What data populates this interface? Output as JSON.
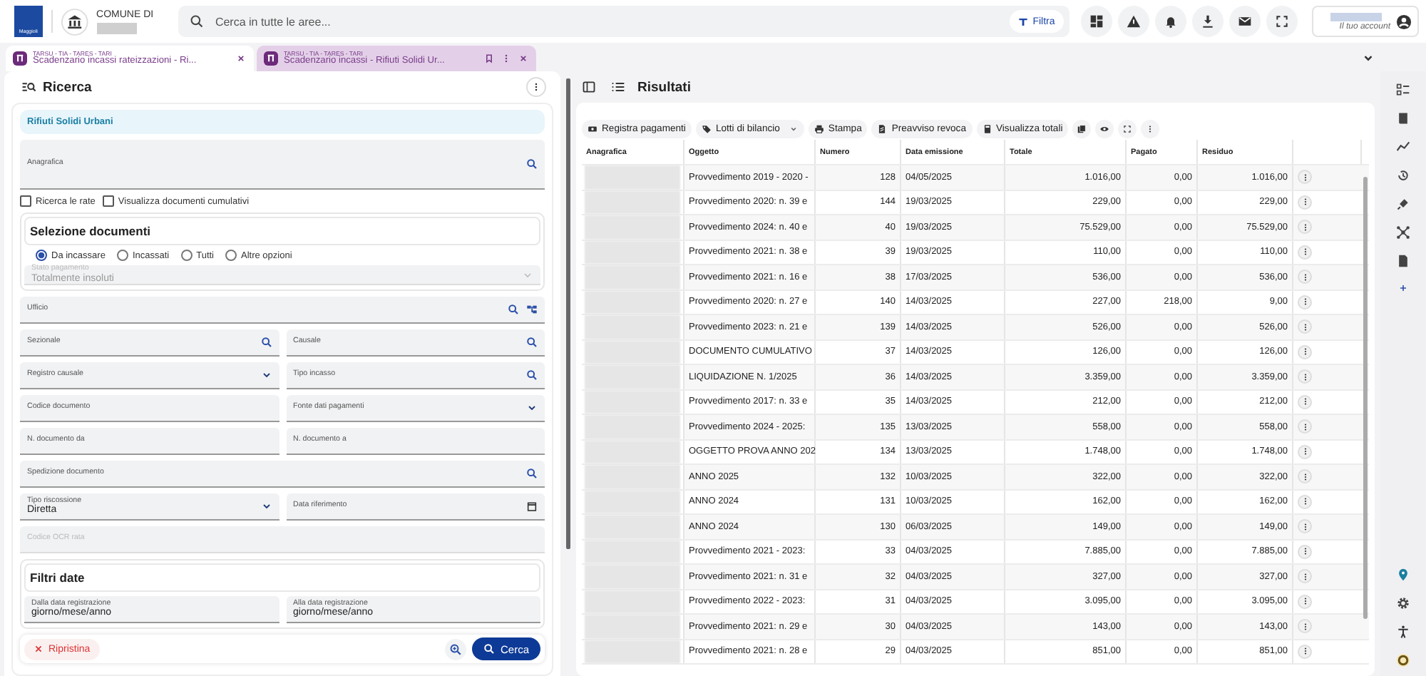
{
  "header": {
    "logo_text": "Maggioli",
    "organization": "COMUNE DI",
    "search": {
      "placeholder": "Cerca in tutte le aree..."
    },
    "filter_button": "Filtra",
    "account": "Il tuo account"
  },
  "tabs": [
    {
      "module": "TARSU - TIA - TARES - TARI",
      "title": "Scadenzario incassi rateizzazioni - Ri...",
      "selected": false
    },
    {
      "module": "TARSU - TIA - TARES - TARI",
      "title": "Scadenzario incassi - Rifiuti Solidi Ur...",
      "selected": true
    }
  ],
  "search_panel": {
    "title": "Ricerca",
    "banner": "Rifiuti Solidi Urbani",
    "anagrafica": {
      "label": "Anagrafica",
      "kind": "lookup",
      "disabled": false
    },
    "checkboxes": [
      {
        "label": "Ricerca le rate",
        "checked": false
      },
      {
        "label": "Visualizza documenti cumulativi",
        "checked": false
      }
    ],
    "selection": {
      "title": "Selezione documenti",
      "radios": [
        {
          "label": "Da incassare",
          "selected": true
        },
        {
          "label": "Incassati",
          "selected": false
        },
        {
          "label": "Tutti",
          "selected": false
        },
        {
          "label": "Altre opzioni",
          "selected": false
        }
      ],
      "state_field": {
        "label": "Stato pagamento",
        "value": "Totalmente insoluti",
        "kind": "select",
        "disabled": true
      }
    },
    "field_rows": [
      [
        {
          "label": "Ufficio",
          "kind": "lookup-tree",
          "disabled": false
        }
      ],
      [
        {
          "label": "Sezionale",
          "kind": "lookup",
          "disabled": false
        },
        {
          "label": "Causale",
          "kind": "lookup",
          "disabled": false
        }
      ],
      [
        {
          "label": "Registro causale",
          "kind": "select",
          "disabled": false
        },
        {
          "label": "Tipo incasso",
          "kind": "lookup",
          "disabled": false
        }
      ],
      [
        {
          "label": "Codice documento",
          "kind": "text",
          "disabled": false
        },
        {
          "label": "Fonte dati pagamenti",
          "kind": "select",
          "disabled": false
        }
      ],
      [
        {
          "label": "N. documento da",
          "kind": "text",
          "disabled": false
        },
        {
          "label": "N. documento a",
          "kind": "text",
          "disabled": false
        }
      ],
      [
        {
          "label": "Spedizione documento",
          "kind": "lookup",
          "disabled": false
        }
      ],
      [
        {
          "label": "Tipo riscossione",
          "value": "Diretta",
          "kind": "select",
          "disabled": false
        },
        {
          "label": "Data riferimento",
          "kind": "date",
          "disabled": false
        }
      ],
      [
        {
          "label": "Codice OCR rata",
          "kind": "text",
          "disabled": true
        }
      ]
    ],
    "date_filters": {
      "title": "Filtri date",
      "fields": [
        {
          "label": "Dalla data registrazione",
          "value": "giorno/mese/anno",
          "disabled": false
        },
        {
          "label": "Alla data registrazione",
          "value": "giorno/mese/anno",
          "disabled": false
        }
      ]
    },
    "reset_button": "Ripristina",
    "search_button": "Cerca"
  },
  "results": {
    "title": "Risultati",
    "toolbar": [
      {
        "label": "Registra pagamenti",
        "dropdown": false
      },
      {
        "label": "Lotti di bilancio",
        "dropdown": true
      },
      {
        "label": "Stampa",
        "dropdown": false
      },
      {
        "label": "Preavviso revoca",
        "dropdown": false
      },
      {
        "label": "Visualizza totali",
        "dropdown": false
      }
    ],
    "columns": [
      "Anagrafica",
      "Oggetto",
      "Numero",
      "Data emissione",
      "Totale",
      "Pagato",
      "Residuo"
    ],
    "rows": [
      [
        "",
        "Provvedimento 2019 - 2020 -",
        "128",
        "04/05/2025",
        "1.016,00",
        "0,00",
        "1.016,00"
      ],
      [
        "",
        "Provvedimento 2020: n. 39 e",
        "144",
        "19/03/2025",
        "229,00",
        "0,00",
        "229,00"
      ],
      [
        "",
        "Provvedimento 2024: n. 40 e",
        "40",
        "19/03/2025",
        "75.529,00",
        "0,00",
        "75.529,00"
      ],
      [
        "",
        "Provvedimento 2021: n. 38 e",
        "39",
        "19/03/2025",
        "110,00",
        "0,00",
        "110,00"
      ],
      [
        "",
        "Provvedimento 2021: n. 16 e",
        "38",
        "17/03/2025",
        "536,00",
        "0,00",
        "536,00"
      ],
      [
        "",
        "Provvedimento 2020: n. 27 e",
        "140",
        "14/03/2025",
        "227,00",
        "218,00",
        "9,00"
      ],
      [
        "",
        "Provvedimento 2023: n. 21 e",
        "139",
        "14/03/2025",
        "526,00",
        "0,00",
        "526,00"
      ],
      [
        "",
        "DOCUMENTO CUMULATIVO",
        "37",
        "14/03/2025",
        "126,00",
        "0,00",
        "126,00"
      ],
      [
        "",
        "LIQUIDAZIONE N. 1/2025",
        "36",
        "14/03/2025",
        "3.359,00",
        "0,00",
        "3.359,00"
      ],
      [
        "",
        "Provvedimento 2017: n. 33 e",
        "35",
        "14/03/2025",
        "212,00",
        "0,00",
        "212,00"
      ],
      [
        "",
        "Provvedimento 2024 - 2025:",
        "135",
        "13/03/2025",
        "558,00",
        "0,00",
        "558,00"
      ],
      [
        "",
        "OGGETTO PROVA ANNO 202",
        "134",
        "13/03/2025",
        "1.748,00",
        "0,00",
        "1.748,00"
      ],
      [
        "",
        "ANNO 2025",
        "132",
        "10/03/2025",
        "322,00",
        "0,00",
        "322,00"
      ],
      [
        "",
        "ANNO 2024",
        "131",
        "10/03/2025",
        "162,00",
        "0,00",
        "162,00"
      ],
      [
        "",
        "ANNO 2024",
        "130",
        "06/03/2025",
        "149,00",
        "0,00",
        "149,00"
      ],
      [
        "",
        "Provvedimento 2021 - 2023:",
        "33",
        "04/03/2025",
        "7.885,00",
        "0,00",
        "7.885,00"
      ],
      [
        "",
        "Provvedimento 2021: n. 31 e",
        "32",
        "04/03/2025",
        "327,00",
        "0,00",
        "327,00"
      ],
      [
        "",
        "Provvedimento 2022 - 2023:",
        "31",
        "04/03/2025",
        "3.095,00",
        "0,00",
        "3.095,00"
      ],
      [
        "",
        "Provvedimento 2021: n. 29 e",
        "30",
        "04/03/2025",
        "143,00",
        "0,00",
        "143,00"
      ],
      [
        "",
        "Provvedimento 2021: n. 28 e",
        "29",
        "04/03/2025",
        "851,00",
        "0,00",
        "851,00"
      ]
    ]
  }
}
